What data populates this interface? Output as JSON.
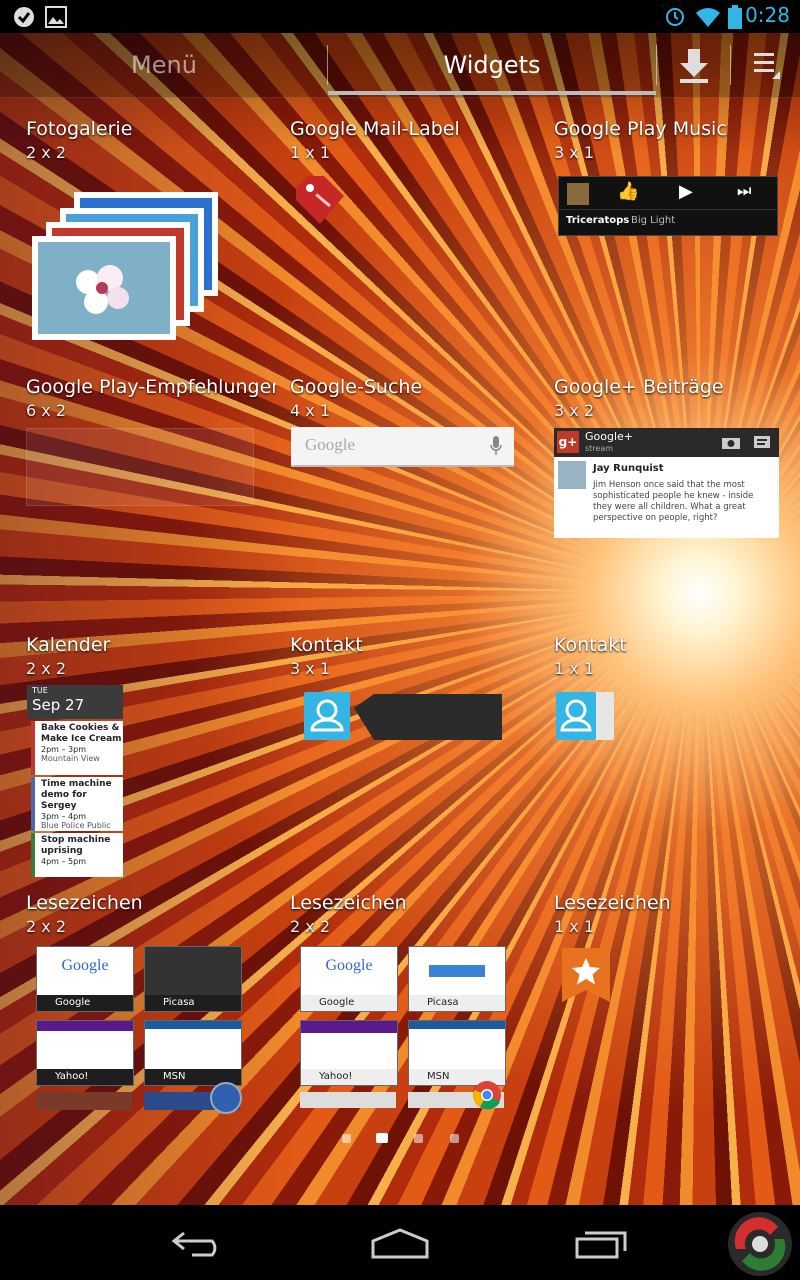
{
  "status_bar": {
    "time": "0:28",
    "left_icons": [
      "task-icon",
      "image-icon"
    ],
    "right_icons": [
      "alarm-icon",
      "wifi-icon",
      "battery-icon"
    ]
  },
  "tabs": {
    "menu": "Menü",
    "widgets": "Widgets"
  },
  "actions": [
    "download-icon",
    "overflow-menu-icon"
  ],
  "widgets": [
    {
      "title": "Fotogalerie",
      "size": "2 x 2"
    },
    {
      "title": "Google Mail-Label",
      "size": "1 x 1"
    },
    {
      "title": "Google Play Music",
      "size": "3 x 1"
    },
    {
      "title": "Google Play-Empfehlungen",
      "size": "6 x 2"
    },
    {
      "title": "Google-Suche",
      "size": "4 x 1"
    },
    {
      "title": "Google+ Beiträge",
      "size": "3 x 2"
    },
    {
      "title": "Kalender",
      "size": "2 x 2"
    },
    {
      "title": "Kontakt",
      "size": "3 x 1"
    },
    {
      "title": "Kontakt",
      "size": "1 x 1"
    },
    {
      "title": "Lesezeichen",
      "size": "2 x 2"
    },
    {
      "title": "Lesezeichen",
      "size": "2 x 2"
    },
    {
      "title": "Lesezeichen",
      "size": "1 x 1"
    }
  ],
  "music": {
    "artist": "Triceratops",
    "album": "Big Light"
  },
  "search": {
    "logo": "Google"
  },
  "gplus": {
    "title": "Google+",
    "subtitle": "stream",
    "author": "Jay Runquist",
    "text": "Jim Henson once said that the most sophisticated people he knew - inside they were all children. What a great perspective on people, right?"
  },
  "calendar": {
    "day": "TUE",
    "date": "Sep 27",
    "events": [
      {
        "title": "Bake Cookies & Make Ice Cream",
        "time": "2pm – 3pm",
        "place": "Mountain View"
      },
      {
        "title": "Time machine demo for Sergey",
        "time": "3pm – 4pm",
        "place": "Blue Police Public"
      },
      {
        "title": "Stop machine uprising",
        "time": "4pm – 5pm",
        "place": ""
      }
    ]
  },
  "bookmarks": [
    "Google",
    "Picasa",
    "Yahoo!",
    "MSN"
  ],
  "page_indicator": {
    "count": 4,
    "current": 2
  },
  "nav": [
    "back-icon",
    "home-icon",
    "recents-icon",
    "app-logo-icon"
  ]
}
